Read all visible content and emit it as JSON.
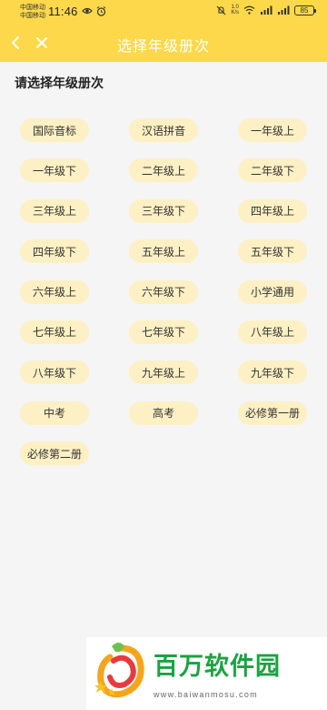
{
  "status_bar": {
    "carrier_1": "中国移动",
    "carrier_2": "中国移动",
    "time": "11:46",
    "net_speed_value": "1.0",
    "net_speed_unit": "K/s",
    "battery": "85"
  },
  "header": {
    "title": "选择年级册次",
    "back_icon": "chevron-left-icon",
    "close_icon": "close-icon",
    "background_color": "#fcd84a"
  },
  "main": {
    "section_title": "请选择年级册次",
    "options": [
      "国际音标",
      "汉语拼音",
      "一年级上",
      "一年级下",
      "二年级上",
      "二年级下",
      "三年级上",
      "三年级下",
      "四年级上",
      "四年级下",
      "五年级上",
      "五年级下",
      "六年级上",
      "六年级下",
      "小学通用",
      "七年级上",
      "七年级下",
      "八年级上",
      "八年级下",
      "九年级上",
      "九年级下",
      "中考",
      "高考",
      "必修第一册",
      "必修第二册"
    ],
    "chip_color": "#fdf0c4"
  },
  "watermark": {
    "title": "百万软件园",
    "url": "www.baiwanmosu.com",
    "color": "#1aa340"
  }
}
